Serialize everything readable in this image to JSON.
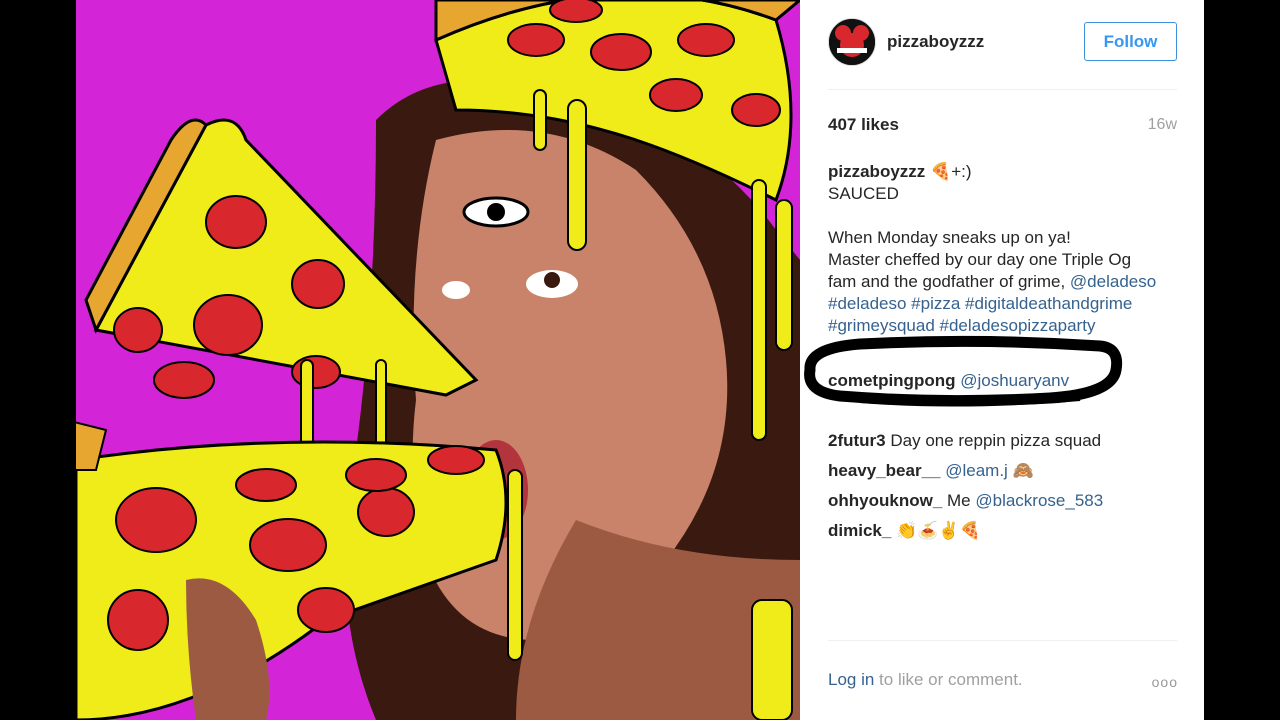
{
  "post": {
    "username": "pizzaboyzzz",
    "follow_label": "Follow",
    "likes": "407 likes",
    "age": "16w",
    "caption_author": "pizzaboyzzz",
    "caption_emoji": "🍕+:)",
    "caption_line1": "SAUCED",
    "caption_line2": "When Monday sneaks up on ya!",
    "caption_line3": "Master cheffed by our day one Triple Og",
    "caption_line4_text": "fam and the godfather of grime, ",
    "caption_line4_link": "@deladeso",
    "hashtags_line1": "#deladeso #pizza #digitaldeathandgrime",
    "hashtags_line2": "#grimeysquad #deladesopizzaparty"
  },
  "comments": [
    {
      "user": "cometpingpong",
      "text": "@joshuaryanv",
      "is_link": true
    },
    {
      "user": "2futur3",
      "text": "Day one reppin pizza squad",
      "is_link": false
    },
    {
      "user": "heavy_bear__",
      "text": "@leam.j",
      "suffix": "🙈",
      "is_link": true
    },
    {
      "user": "ohhyouknow_",
      "text_plain": "Me ",
      "text": "@blackrose_583",
      "is_link": true
    },
    {
      "user": "dimick_",
      "text": "👏🍝✌🍕",
      "is_link": false
    }
  ],
  "footer": {
    "login_label": "Log in",
    "rest": " to like or comment.",
    "more_label": "ooo"
  },
  "colors": {
    "background": "#d324d8",
    "cheese": "#f0ec1a",
    "pepperoni": "#d8272d",
    "link": "#35628f",
    "follow": "#3897f0"
  }
}
